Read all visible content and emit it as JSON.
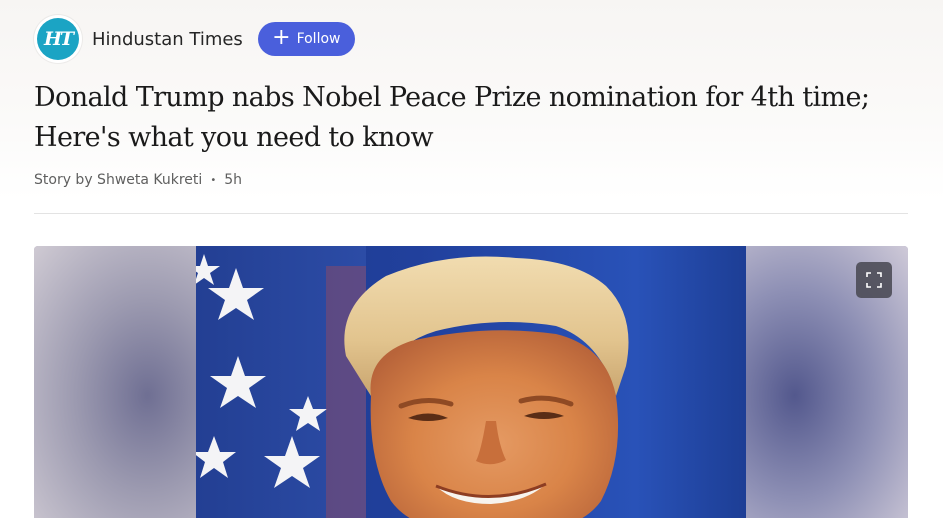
{
  "publisher": {
    "logo_text": "HT",
    "name": "Hindustan Times",
    "follow_label": "Follow",
    "follow_icon": "plus-icon"
  },
  "article": {
    "headline": "Donald Trump nabs Nobel Peace Prize nomination for 4th time; Here's what you need to know",
    "byline": {
      "author": "Story by Shweta Kukreti",
      "separator": "•",
      "time": "5h"
    }
  },
  "media": {
    "description_icon": "fullscreen-icon",
    "accent_colors": {
      "follow_button": "#4a5fdc",
      "logo_background": "#1ba4c4"
    }
  }
}
